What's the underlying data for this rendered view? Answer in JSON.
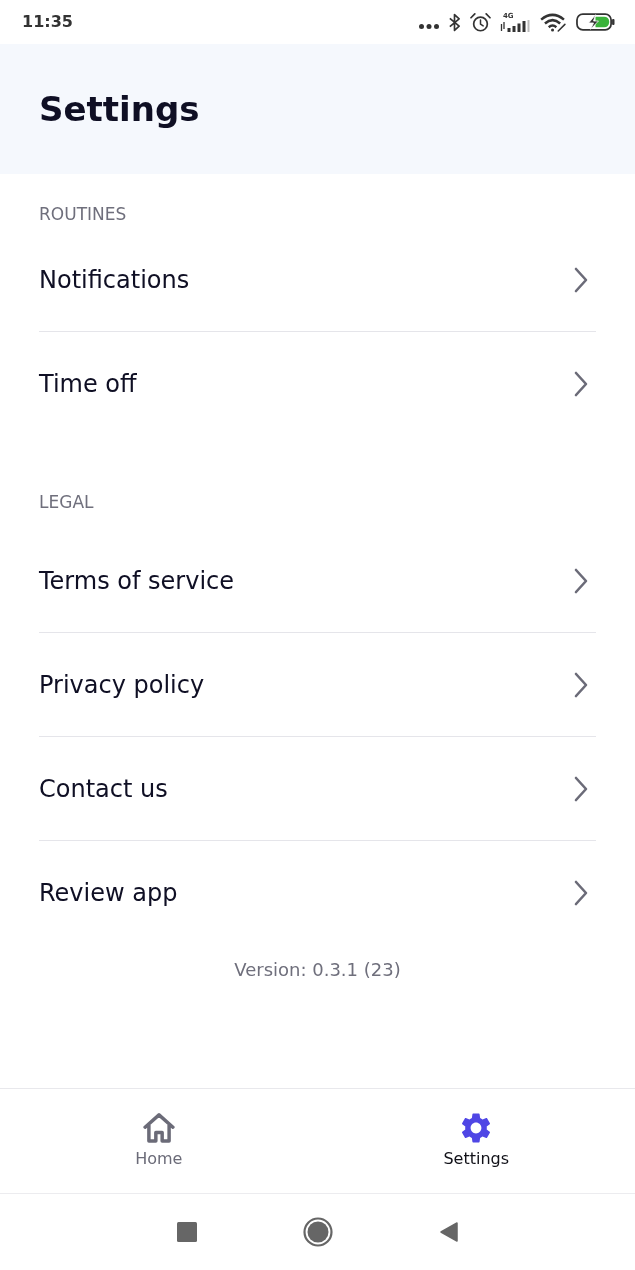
{
  "status_bar": {
    "time": "11:35",
    "network": "4G"
  },
  "header": {
    "title": "Settings"
  },
  "sections": [
    {
      "title": "ROUTINES",
      "items": [
        {
          "label": "Notifications"
        },
        {
          "label": "Time off"
        }
      ]
    },
    {
      "title": "LEGAL",
      "items": [
        {
          "label": "Terms of service"
        },
        {
          "label": "Privacy policy"
        },
        {
          "label": "Contact us"
        },
        {
          "label": "Review app"
        }
      ]
    }
  ],
  "version": "Version: 0.3.1 (23)",
  "bottom_nav": [
    {
      "kind": "home",
      "label": "Home",
      "selected": false
    },
    {
      "kind": "settings",
      "label": "Settings",
      "selected": true
    }
  ]
}
